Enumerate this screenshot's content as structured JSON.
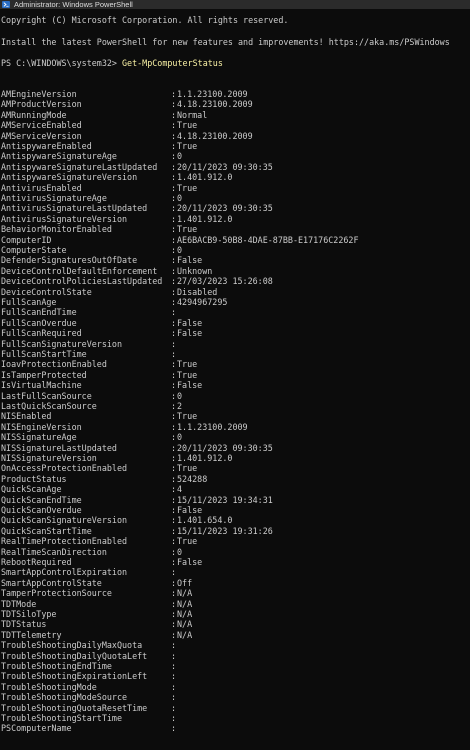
{
  "window": {
    "title": "Administrator: Windows PowerShell"
  },
  "header_lines": [
    "Copyright (C) Microsoft Corporation. All rights reserved.",
    "",
    "Install the latest PowerShell for new features and improvements! https://aka.ms/PSWindows",
    "",
    "PS C:\\WINDOWS\\system32> "
  ],
  "prompt": {
    "path": "PS C:\\WINDOWS\\system32> ",
    "command": "Get-MpComputerStatus"
  },
  "properties": [
    {
      "key": "AMEngineVersion",
      "value": "1.1.23100.2009"
    },
    {
      "key": "AMProductVersion",
      "value": "4.18.23100.2009"
    },
    {
      "key": "AMRunningMode",
      "value": "Normal"
    },
    {
      "key": "AMServiceEnabled",
      "value": "True"
    },
    {
      "key": "AMServiceVersion",
      "value": "4.18.23100.2009"
    },
    {
      "key": "AntispywareEnabled",
      "value": "True"
    },
    {
      "key": "AntispywareSignatureAge",
      "value": "0"
    },
    {
      "key": "AntispywareSignatureLastUpdated",
      "value": "20/11/2023 09:30:35"
    },
    {
      "key": "AntispywareSignatureVersion",
      "value": "1.401.912.0"
    },
    {
      "key": "AntivirusEnabled",
      "value": "True"
    },
    {
      "key": "AntivirusSignatureAge",
      "value": "0"
    },
    {
      "key": "AntivirusSignatureLastUpdated",
      "value": "20/11/2023 09:30:35"
    },
    {
      "key": "AntivirusSignatureVersion",
      "value": "1.401.912.0"
    },
    {
      "key": "BehaviorMonitorEnabled",
      "value": "True"
    },
    {
      "key": "ComputerID",
      "value": "AE6BACB9-50B8-4DAE-87BB-E17176C2262F"
    },
    {
      "key": "ComputerState",
      "value": "0"
    },
    {
      "key": "DefenderSignaturesOutOfDate",
      "value": "False"
    },
    {
      "key": "DeviceControlDefaultEnforcement",
      "value": "Unknown"
    },
    {
      "key": "DeviceControlPoliciesLastUpdated",
      "value": "27/03/2023 15:26:08"
    },
    {
      "key": "DeviceControlState",
      "value": "Disabled"
    },
    {
      "key": "FullScanAge",
      "value": "4294967295"
    },
    {
      "key": "FullScanEndTime",
      "value": ""
    },
    {
      "key": "FullScanOverdue",
      "value": "False"
    },
    {
      "key": "FullScanRequired",
      "value": "False"
    },
    {
      "key": "FullScanSignatureVersion",
      "value": ""
    },
    {
      "key": "FullScanStartTime",
      "value": ""
    },
    {
      "key": "IoavProtectionEnabled",
      "value": "True"
    },
    {
      "key": "IsTamperProtected",
      "value": "True"
    },
    {
      "key": "IsVirtualMachine",
      "value": "False"
    },
    {
      "key": "LastFullScanSource",
      "value": "0"
    },
    {
      "key": "LastQuickScanSource",
      "value": "2"
    },
    {
      "key": "NISEnabled",
      "value": "True"
    },
    {
      "key": "NISEngineVersion",
      "value": "1.1.23100.2009"
    },
    {
      "key": "NISSignatureAge",
      "value": "0"
    },
    {
      "key": "NISSignatureLastUpdated",
      "value": "20/11/2023 09:30:35"
    },
    {
      "key": "NISSignatureVersion",
      "value": "1.401.912.0"
    },
    {
      "key": "OnAccessProtectionEnabled",
      "value": "True"
    },
    {
      "key": "ProductStatus",
      "value": "524288"
    },
    {
      "key": "QuickScanAge",
      "value": "4"
    },
    {
      "key": "QuickScanEndTime",
      "value": "15/11/2023 19:34:31"
    },
    {
      "key": "QuickScanOverdue",
      "value": "False"
    },
    {
      "key": "QuickScanSignatureVersion",
      "value": "1.401.654.0"
    },
    {
      "key": "QuickScanStartTime",
      "value": "15/11/2023 19:31:26"
    },
    {
      "key": "RealTimeProtectionEnabled",
      "value": "True"
    },
    {
      "key": "RealTimeScanDirection",
      "value": "0"
    },
    {
      "key": "RebootRequired",
      "value": "False"
    },
    {
      "key": "SmartAppControlExpiration",
      "value": ""
    },
    {
      "key": "SmartAppControlState",
      "value": "Off"
    },
    {
      "key": "TamperProtectionSource",
      "value": "N/A"
    },
    {
      "key": "TDTMode",
      "value": "N/A"
    },
    {
      "key": "TDTSiloType",
      "value": "N/A"
    },
    {
      "key": "TDTStatus",
      "value": "N/A"
    },
    {
      "key": "TDTTelemetry",
      "value": "N/A"
    },
    {
      "key": "TroubleShootingDailyMaxQuota",
      "value": ""
    },
    {
      "key": "TroubleShootingDailyQuotaLeft",
      "value": ""
    },
    {
      "key": "TroubleShootingEndTime",
      "value": ""
    },
    {
      "key": "TroubleShootingExpirationLeft",
      "value": ""
    },
    {
      "key": "TroubleShootingMode",
      "value": ""
    },
    {
      "key": "TroubleShootingModeSource",
      "value": ""
    },
    {
      "key": "TroubleShootingQuotaResetTime",
      "value": ""
    },
    {
      "key": "TroubleShootingStartTime",
      "value": ""
    },
    {
      "key": "PSComputerName",
      "value": ""
    }
  ],
  "separator": ":",
  "colors": {
    "background": "#0c0c0c",
    "text": "#cccccc",
    "command": "#f9f1a5",
    "titlebar": "#2b2b2b"
  },
  "icons": {
    "title": "powershell-icon"
  }
}
